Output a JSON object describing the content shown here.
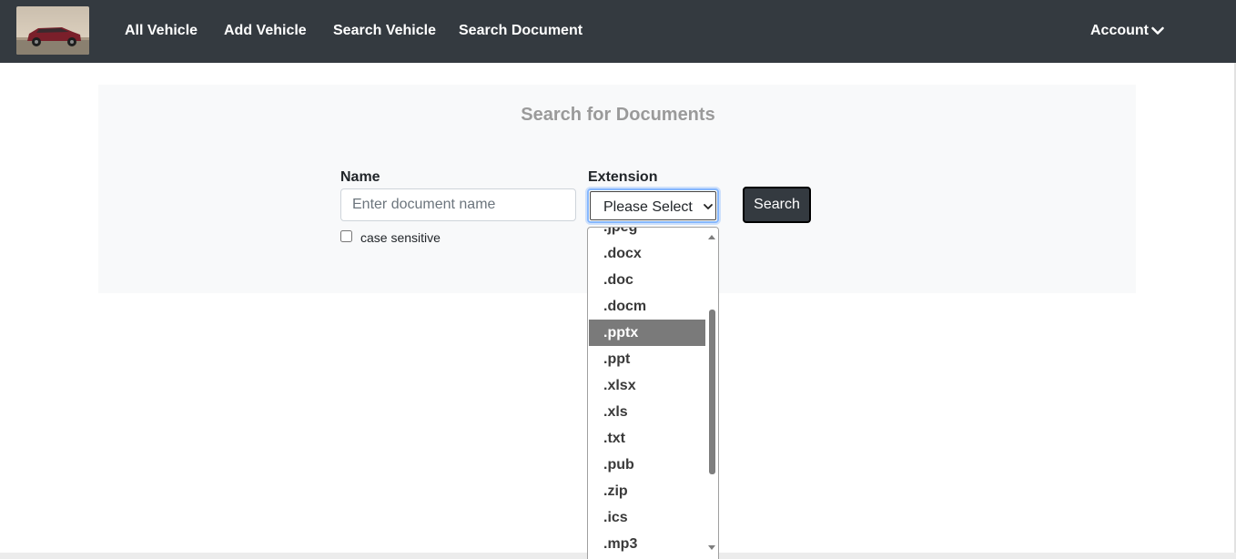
{
  "navbar": {
    "links": [
      "All Vehicle",
      "Add Vehicle",
      "Search Vehicle",
      "Search Document"
    ],
    "account_label": "Account"
  },
  "panel": {
    "title": "Search for Documents"
  },
  "form": {
    "name_label": "Name",
    "name_placeholder": "Enter document name",
    "name_value": "",
    "case_sensitive_label": "case sensitive",
    "case_sensitive_checked": false,
    "extension_label": "Extension",
    "extension_selected": "Please Select",
    "search_button": "Search"
  },
  "dropdown": {
    "options": [
      ".jpeg",
      ".docx",
      ".doc",
      ".docm",
      ".pptx",
      ".ppt",
      ".xlsx",
      ".xls",
      ".txt",
      ".pub",
      ".zip",
      ".ics",
      ".mp3"
    ],
    "highlighted": ".pptx"
  },
  "colors": {
    "navbar": "#343a40",
    "panel": "#f8f9fa",
    "title": "#9a9a9a",
    "highlight": "#7a7a7a"
  }
}
